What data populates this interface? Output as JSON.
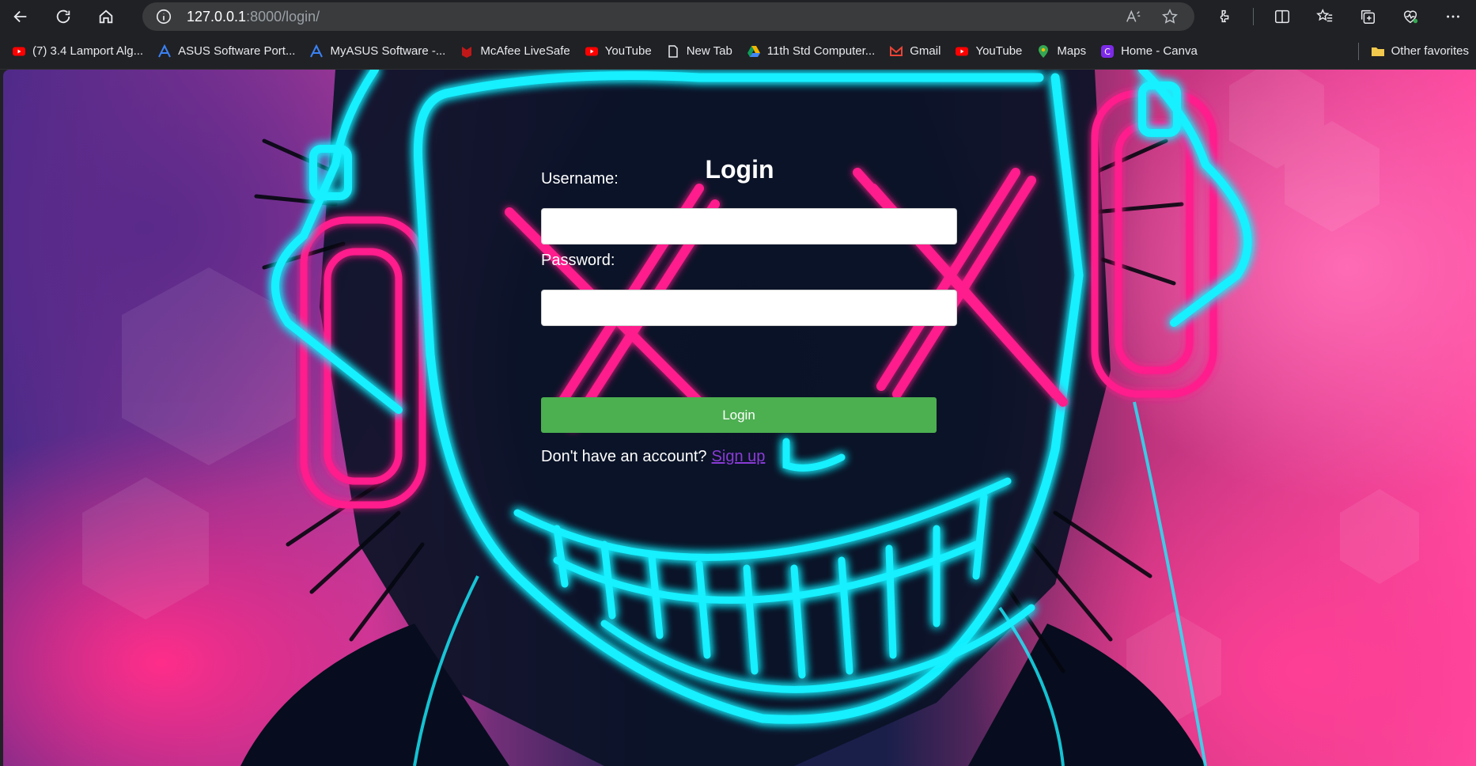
{
  "browser": {
    "url_host": "127.0.0.1",
    "url_rest": ":8000/login/",
    "bookmarks": [
      {
        "label": "(7) 3.4 Lamport Alg...",
        "icon": "youtube-icon",
        "color": "#ff0000"
      },
      {
        "label": "ASUS Software Port...",
        "icon": "asus-icon",
        "color": "#3b82f6"
      },
      {
        "label": "MyASUS Software -...",
        "icon": "asus-icon",
        "color": "#3b82f6"
      },
      {
        "label": "McAfee LiveSafe",
        "icon": "mcafee-icon",
        "color": "#c01818"
      },
      {
        "label": "YouTube",
        "icon": "youtube-icon",
        "color": "#ff0000"
      },
      {
        "label": "New Tab",
        "icon": "page-icon",
        "color": "#e8eaed"
      },
      {
        "label": "11th Std Computer...",
        "icon": "drive-icon",
        "color": "#f4b400"
      },
      {
        "label": "Gmail",
        "icon": "gmail-icon",
        "color": "#ea4335"
      },
      {
        "label": "YouTube",
        "icon": "youtube-icon",
        "color": "#ff0000"
      },
      {
        "label": "Maps",
        "icon": "maps-icon",
        "color": "#34a853"
      },
      {
        "label": "Home - Canva",
        "icon": "canva-icon",
        "color": "#00c4cc"
      }
    ],
    "other_favorites": "Other favorites"
  },
  "login": {
    "title": "Login",
    "username_label": "Username:",
    "password_label": "Password:",
    "button_label": "Login",
    "signup_prompt": "Don't have an account?",
    "signup_link": "Sign up"
  },
  "colors": {
    "button": "#4caf50",
    "neon_cyan": "#19f0ff",
    "neon_pink": "#ff1e8c",
    "link": "#8a3bd6"
  }
}
